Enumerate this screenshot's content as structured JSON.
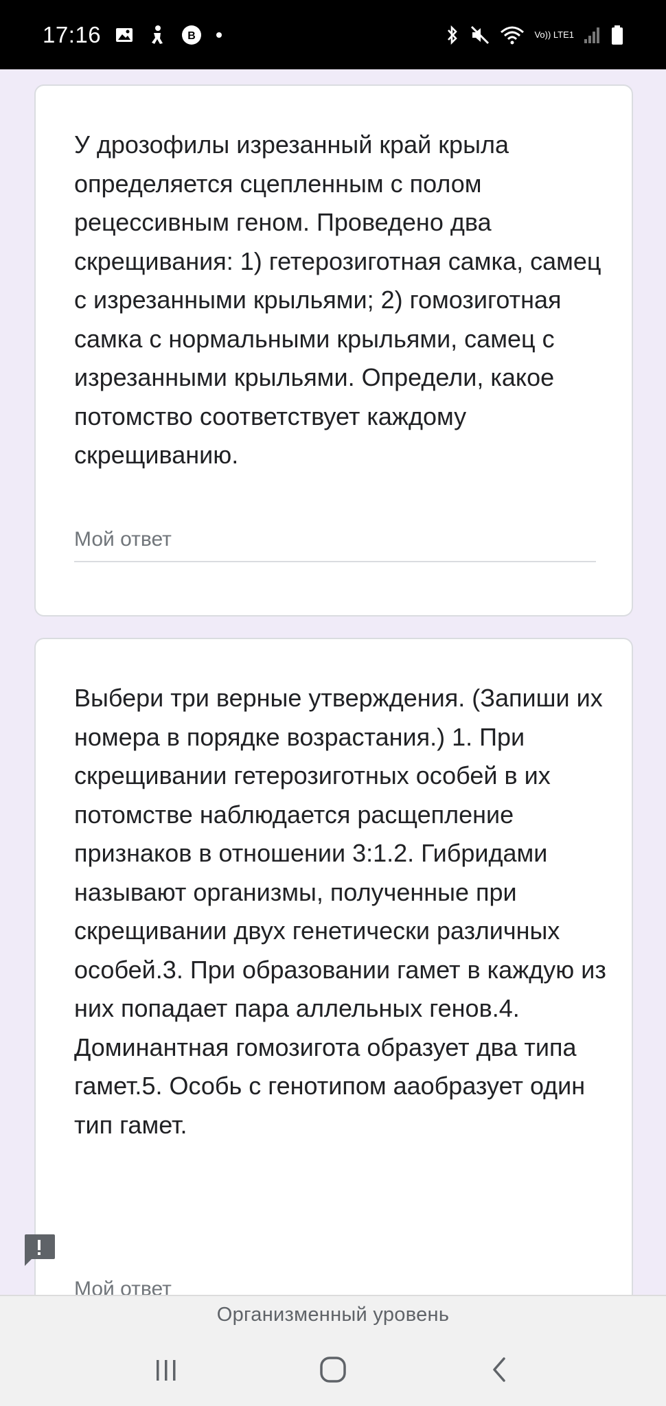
{
  "status_bar": {
    "time": "17:16",
    "network_label": "Vo)) LTE1",
    "icons": [
      "gallery-icon",
      "accessibility-icon",
      "vk-icon",
      "dot-icon",
      "bluetooth-icon",
      "mute-icon",
      "wifi-icon",
      "signal-icon",
      "battery-icon"
    ]
  },
  "questions": [
    {
      "text": "У дрозофилы изрезанный край крыла определяется сцепленным с полом рецессивным геном. Проведено два скрещивания: 1) гетерозиготная самка, самец с изрезанными крыльями; 2) гомозиготная самка с нормальными крыльями, самец с изрезанными крыльями. Определи, какое потомство соответствует каждому скрещиванию.",
      "answer_placeholder": "Мой ответ"
    },
    {
      "text": "Выбери три верные утверждения. (Запиши их номера в порядке возрастания.) 1. При скрещивании гетерозиготных особей в их потомстве наблюдается расщепление признаков в отношении 3:1.2. Гибридами называют организмы, полученные при скрещивании двух генетически различных особей.3. При образовании гамет в каждую из них попадает пара аллельных генов.4. Доминантная гомозигота образует два типа гамет.5. Особь с генотипом ааобразует один тип гамет.",
      "answer_placeholder": "Мой ответ"
    }
  ],
  "bottom_title": "Организменный уровень",
  "nav": {
    "buttons": [
      "recents-icon",
      "home-icon",
      "back-icon"
    ]
  },
  "colors": {
    "background": "#f0ebf8",
    "card": "#ffffff",
    "card_border": "#dadce0",
    "text": "#202124",
    "placeholder": "#70757a",
    "feedback": "#5f6368"
  }
}
